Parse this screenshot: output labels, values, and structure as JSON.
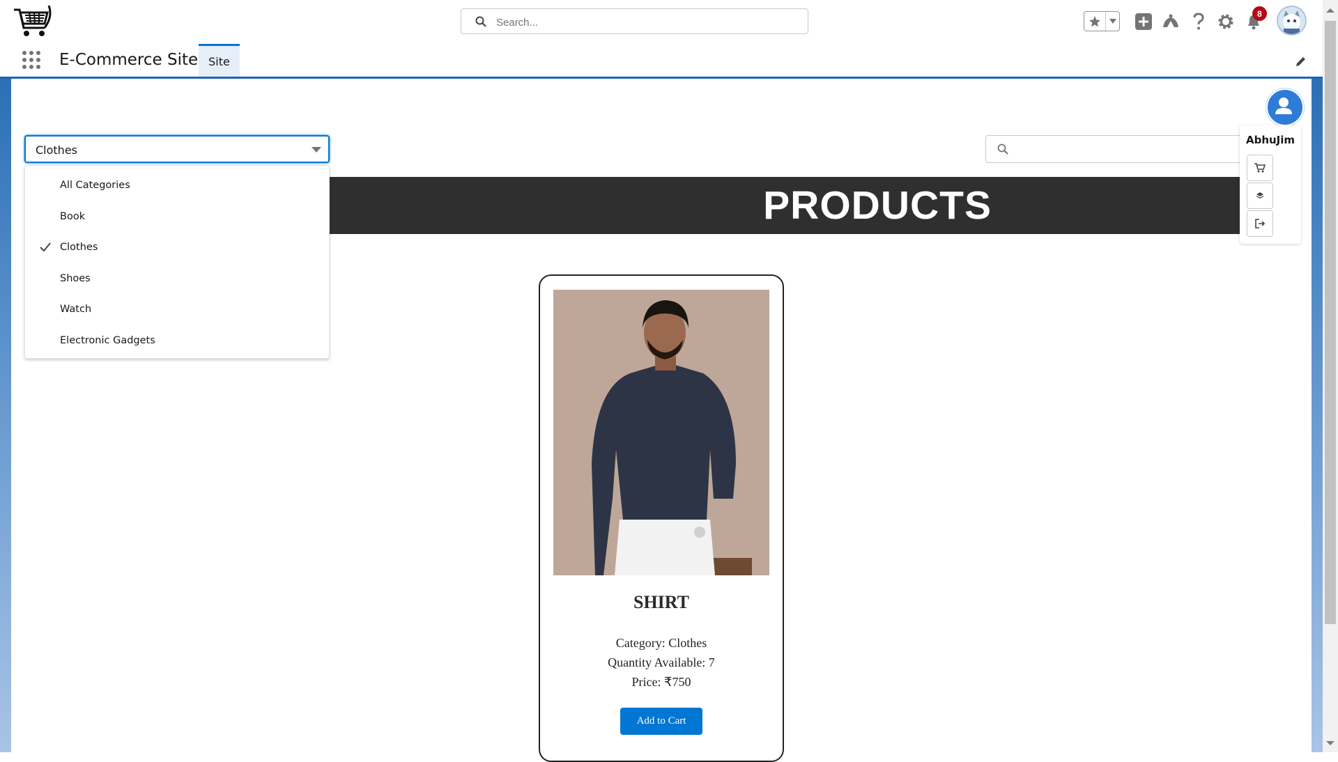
{
  "header": {
    "search_placeholder": "Search...",
    "notification_count": "8"
  },
  "nav": {
    "app_name": "E-Commerce Site",
    "tab_label": "Site"
  },
  "filter": {
    "selected_category": "Clothes",
    "options": [
      "All Categories",
      "Book",
      "Clothes",
      "Shoes",
      "Watch",
      "Electronic Gadgets"
    ]
  },
  "banner": {
    "title": "PRODUCTS"
  },
  "user": {
    "name": "AbhuJim"
  },
  "product": {
    "name": "SHIRT",
    "category_line": "Category: Clothes",
    "quantity_line": "Quantity Available: 7",
    "price_line": "Price: ₹750",
    "add_label": "Add to Cart"
  },
  "colors": {
    "brand_blue": "#0176d3",
    "banner_bg": "#2f2f2f",
    "badge_red": "#ba0517"
  }
}
